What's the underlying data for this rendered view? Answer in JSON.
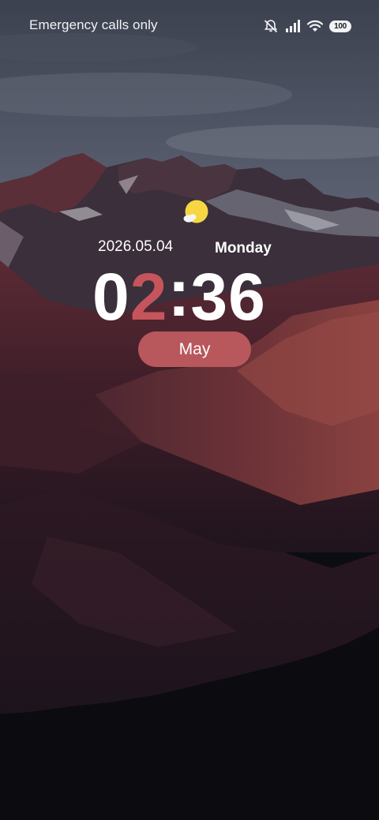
{
  "status_bar": {
    "carrier_text": "Emergency calls only",
    "icons": [
      "silent-mode-icon",
      "signal-icon",
      "wifi-icon",
      "battery-icon"
    ],
    "battery_level": "100"
  },
  "lock_screen": {
    "weather_icon": "partly-sunny-icon",
    "date": "2026.05.04",
    "weekday": "Monday",
    "time": {
      "hour_first_digit": "0",
      "hour_second_digit": "2",
      "separator": ":",
      "minutes": "36"
    },
    "month": "May"
  },
  "colors": {
    "accent": "#c6545c",
    "month_pill": "#b8575c",
    "text": "#ffffff"
  }
}
